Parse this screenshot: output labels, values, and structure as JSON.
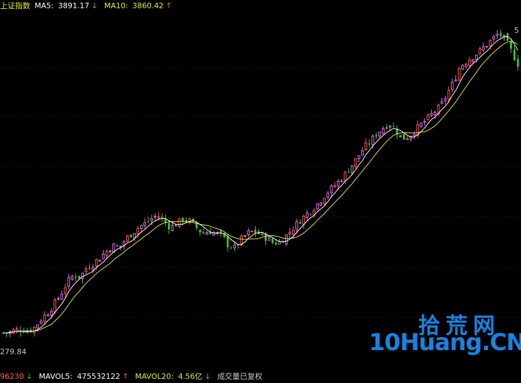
{
  "header": {
    "index_name": "上证指数",
    "ma5_label": "MA5:",
    "ma5_value": "3891.17",
    "ma5_arrow": "↓",
    "ma10_label": "MA10:",
    "ma10_value": "3860.42",
    "ma10_arrow": "↑"
  },
  "axis": {
    "min_label": "279.84",
    "max_label": "5"
  },
  "footer": {
    "vol_value": "96230",
    "vol_arrow": "↓",
    "mavol5_label": "MAVOL5:",
    "mavol5_value": "475532122",
    "mavol5_arrow": "↑",
    "mavol20_label": "MAVOL20:",
    "mavol20_value": "4.56亿",
    "mavol20_arrow": "↓",
    "note": "成交量已复权"
  },
  "watermark": {
    "chinese": "拾荒网",
    "english": "10Huang.CN"
  },
  "colors": {
    "background": "#000000",
    "up": "#ff5b5b",
    "up_hollow": "#e070e0",
    "down": "#33cc33",
    "ma5": "#ffffff",
    "ma10": "#e6e63c",
    "grid": "#3a0a0a",
    "label": "#c8c8c8",
    "watermark": "#1a82e0"
  },
  "chart_data": {
    "type": "candlestick",
    "title": "上证指数",
    "series": [
      {
        "name": "MA5",
        "last_value": 3891.17
      },
      {
        "name": "MA10",
        "last_value": 3860.42
      }
    ],
    "ylim_low_label": 279.84,
    "trend_close": [
      2280,
      2285,
      2300,
      2310,
      2295,
      2330,
      2400,
      2450,
      2520,
      2600,
      2700,
      2760,
      2740,
      2820,
      2850,
      2900,
      2950,
      3000,
      2980,
      3050,
      3100,
      3150,
      3180,
      3220,
      3250,
      3200,
      3150,
      3180,
      3220,
      3200,
      3150,
      3100,
      3120,
      3100,
      3080,
      3000,
      2980,
      3050,
      3100,
      3120,
      3090,
      3060,
      3020,
      3030,
      3080,
      3140,
      3200,
      3250,
      3300,
      3350,
      3420,
      3470,
      3520,
      3580,
      3650,
      3720,
      3800,
      3850,
      3920,
      3970,
      4010,
      3950,
      3880,
      3900,
      3950,
      4000,
      4050,
      4100,
      4150,
      4250,
      4350,
      4480,
      4520,
      4560,
      4600,
      4650,
      4700,
      4750,
      4700,
      4600,
      4500
    ]
  }
}
